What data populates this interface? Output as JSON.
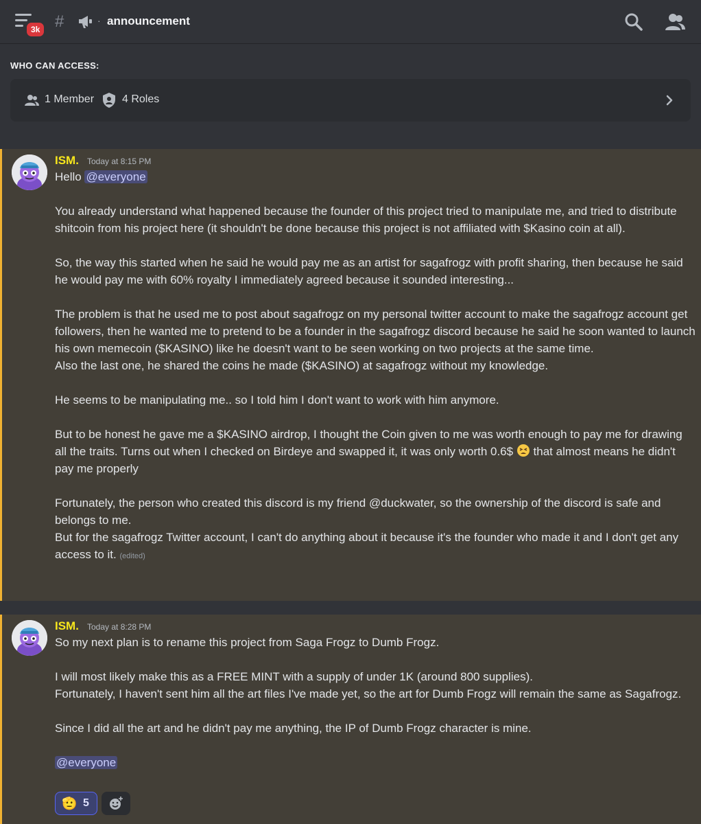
{
  "header": {
    "badge": "3k",
    "channel_name": "announcement",
    "separator": "·",
    "icons": [
      "hamburger-menu-icon",
      "channel-hash-icon",
      "megaphone-icon",
      "search-icon",
      "members-icon"
    ]
  },
  "access": {
    "label": "WHO CAN ACCESS:",
    "members": "1 Member",
    "roles": "4 Roles"
  },
  "colors": {
    "background": "#313338",
    "highlight": "#433f37",
    "highlight_border": "#f0b232",
    "author": "#f8e71c",
    "mention_bg": "#5865f2"
  },
  "messages": [
    {
      "author": "ISM.",
      "timestamp": "Today at 8:15 PM",
      "greeting": "Hello ",
      "mention": "@everyone",
      "p1": "You already understand what happened because the founder of this project tried to manipulate me, and tried to distribute shitcoin from his project here (it shouldn't be done because this project is not affiliated with $Kasino coin at all).",
      "p2": "So, the way this started when he said he would pay me as an artist for sagafrogz with profit sharing, then because he said he would pay me with 60% royalty I immediately agreed because it sounded interesting...",
      "p3a": "The problem is that he used me to post about sagafrogz on my personal twitter account to make the sagafrogz account get followers, then he wanted me to pretend to be a founder in the sagafrogz discord because he said he soon wanted to launch his own memecoin ($KASINO) like he doesn't want to be seen working on two projects at the same time.",
      "p3b": "Also the last one, he shared the coins he made ($KASINO) at sagafrogz without my knowledge.",
      "p4": "He seems to be manipulating me.. so I told him I don't want to work with him anymore.",
      "p5a": "But to be honest he gave me a $KASINO  airdrop, I thought the Coin given to me was worth enough to pay me for drawing all the traits. Turns out when I checked on Birdeye and swapped it, it was only worth 0.6$ ",
      "p5b": " that almost means he didn't pay me properly",
      "p6a": "Fortunately, the person who created this discord is my friend @duckwater, so the ownership of the discord is safe and belongs to me.",
      "p6b": "But for the sagafrogz Twitter account, I can't do anything about it because it's the founder who made it and I don't get any access to it. ",
      "edited": "(edited)"
    },
    {
      "author": "ISM.",
      "timestamp": "Today at 8:28 PM",
      "p1": "So my next plan is to rename this project from Saga Frogz to Dumb Frogz.",
      "p2a": "I will most likely make this as a FREE MINT with a supply of under 1K (around 800 supplies).",
      "p2b": "Fortunately, I haven't sent him all the art files I've made yet, so the art for Dumb Frogz will remain the same as Sagafrogz.",
      "p3": "Since I did all the art and he didn't pay me anything, the IP of Dumb Frogz character is mine.",
      "mention": "@everyone",
      "reaction": {
        "emoji": "🫡",
        "count": "5"
      }
    }
  ]
}
